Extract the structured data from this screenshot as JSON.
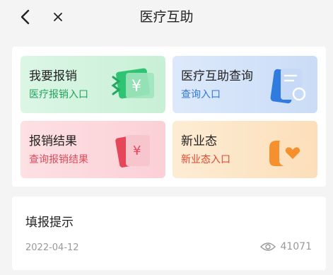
{
  "header": {
    "title": "医疗互助",
    "back_icon": "chevron-left-icon",
    "close_icon": "close-icon"
  },
  "tiles": [
    {
      "title": "我要报销",
      "subtitle": "医疗报销入口",
      "icon": "reimburse-money-icon",
      "accent": "#21a35c"
    },
    {
      "title": "医疗互助查询",
      "subtitle": "查询入口",
      "icon": "query-document-icon",
      "accent": "#2f79d8"
    },
    {
      "title": "报销结果",
      "subtitle": "查询报销结果",
      "icon": "result-receipt-icon",
      "accent": "#e04a5a"
    },
    {
      "title": "新业态",
      "subtitle": "新业态入口",
      "icon": "heart-card-icon",
      "accent": "#e3472f"
    }
  ],
  "notice": {
    "title": "填报提示",
    "date": "2022-04-12",
    "views": "41071",
    "views_icon": "eye-icon"
  }
}
